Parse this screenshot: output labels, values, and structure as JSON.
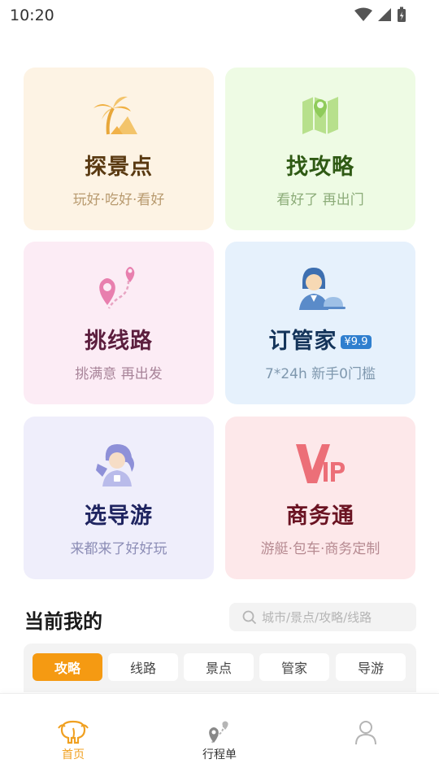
{
  "status_bar": {
    "time": "10:20"
  },
  "colors": {
    "accent": "#f59a12",
    "badge": "#2f7fcf"
  },
  "cards": [
    {
      "title": "探景点",
      "subtitle": "玩好·吃好·看好",
      "icon": "palm-tree-icon"
    },
    {
      "title": "找攻略",
      "subtitle": "看好了 再出门",
      "icon": "map-pin-icon"
    },
    {
      "title": "挑线路",
      "subtitle": "挑满意 再出发",
      "icon": "route-icon"
    },
    {
      "title": "订管家",
      "badge": "¥9.9",
      "subtitle": "7*24h 新手0门槛",
      "icon": "butler-icon"
    },
    {
      "title": "选导游",
      "subtitle": "来都来了好好玩",
      "icon": "tour-guide-icon"
    },
    {
      "title": "商务通",
      "subtitle": "游艇·包车·商务定制",
      "icon": "vip-icon"
    }
  ],
  "section": {
    "title": "当前我的"
  },
  "search": {
    "placeholder": "城市/景点/攻略/线路"
  },
  "tabs": [
    {
      "label": "攻略",
      "active": true
    },
    {
      "label": "线路"
    },
    {
      "label": "景点"
    },
    {
      "label": "管家"
    },
    {
      "label": "导游"
    }
  ],
  "bottom_nav": [
    {
      "label": "首页",
      "icon": "elephant-home-icon",
      "active": true
    },
    {
      "label": "行程单",
      "icon": "itinerary-icon"
    },
    {
      "label": "",
      "icon": "profile-icon"
    }
  ]
}
